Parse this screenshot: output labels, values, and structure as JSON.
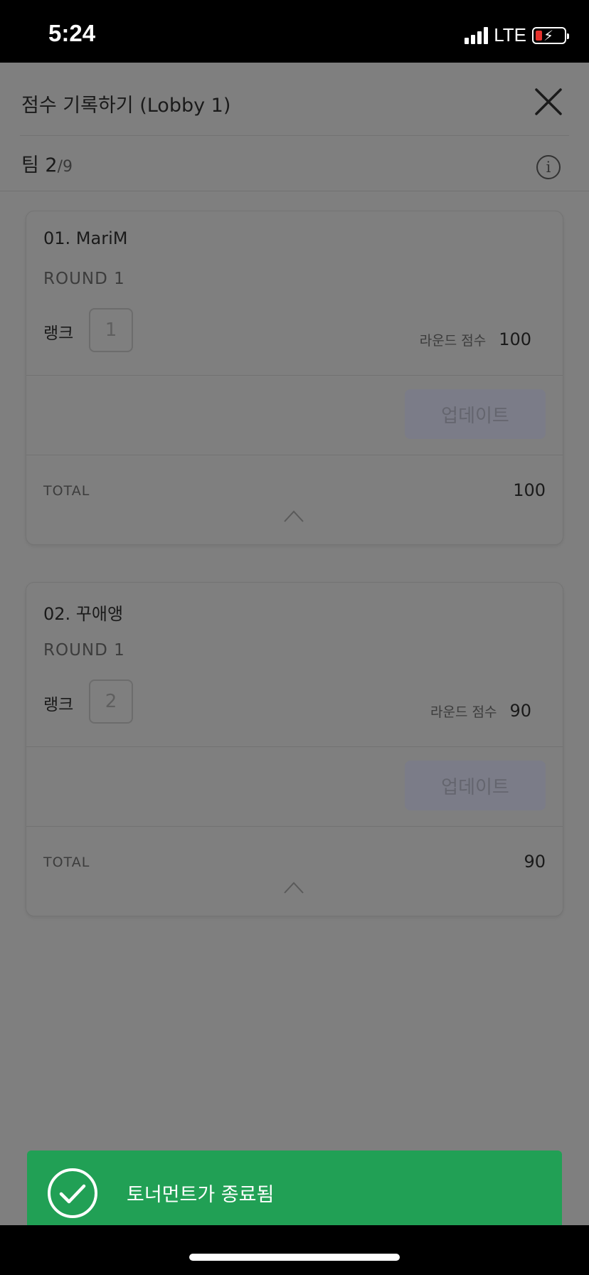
{
  "status_bar": {
    "time": "5:24",
    "network": "LTE",
    "battery_color": "#e5322d"
  },
  "header": {
    "title": "점수 기록하기 (Lobby 1)",
    "close_icon": "close-icon"
  },
  "team_nav": {
    "label": "팀 2",
    "total": "/9",
    "info_icon": "info-icon"
  },
  "cards": [
    {
      "name": "01. MariM",
      "round": "ROUND 1",
      "rank_label": "랭크",
      "rank_value": "1",
      "round_score_label": "라운드 점수",
      "round_score_value": "100",
      "update_label": "업데이트",
      "total_label": "TOTAL",
      "total_value": "100"
    },
    {
      "name": "02. 꾸애앵",
      "round": "ROUND 1",
      "rank_label": "랭크",
      "rank_value": "2",
      "round_score_label": "라운드 점수",
      "round_score_value": "90",
      "update_label": "업데이트",
      "total_label": "TOTAL",
      "total_value": "90"
    }
  ],
  "toast": {
    "message": "토너먼트가 종료됨",
    "color": "#21a055",
    "icon": "check-circle-icon"
  }
}
